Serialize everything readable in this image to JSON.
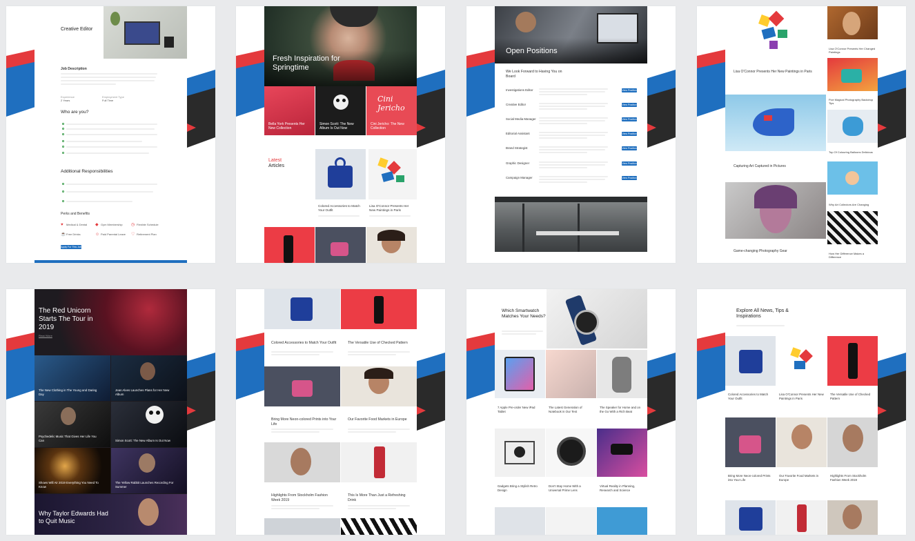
{
  "cards": {
    "c1": {
      "title": "Creative Editor",
      "job_description": "Job Description",
      "experience": "Experience",
      "experience_value": "2 Years",
      "employment": "Employment Type",
      "employment_value": "Full Time",
      "who_are_you": "Who are you?",
      "additional": "Additional Responsibilities",
      "perks": "Perks and Benefits",
      "perk_items": [
        "Medical & Dental",
        "Gym Membership",
        "Flexible Schedule",
        "Free Drinks",
        "Paid Parental Leave",
        "Retirement Plan"
      ],
      "apply": "Apply For This Job"
    },
    "c2": {
      "hero": "Fresh Inspiration for Springtime",
      "tiles": [
        "Bella York Presents Her New Collection",
        "Simon Scott: The New Album Is Out Now",
        "Cini Jericho: The New Collection"
      ],
      "latest_1": "Latest",
      "latest_2": "Articles",
      "articles": [
        "Colored Accessories to Match Your Outfit",
        "Lisa O'Connor Presents Her New Paintings in Paris"
      ]
    },
    "c3": {
      "hero": "Open Positions",
      "subheading": "We Look Forward to Having You on Board",
      "positions": [
        "Investigations Editor",
        "Creative Editor",
        "Social Media Manager",
        "Editorial Assistant",
        "Brand Strategist",
        "Graphic Designer",
        "Campaign Manager"
      ],
      "view_label": "View Position"
    },
    "c4": {
      "items": [
        "Lisa O'Connor Presents Her New Paintings in Paris",
        "Capturing Art Captured in Pictures",
        "Game-changing Photography Gear"
      ],
      "side_items": [
        "Lisa O'Connor Presents Her Changed Paintings",
        "Five Magical Photography Backdrop Tips",
        "Top Of Colouring Balloons Delicious",
        "Why Art Collectors Are Changing",
        "How Her Difference Makes a Difference"
      ]
    },
    "c5": {
      "hero": "The Red Unicorn Starts The Tour in 2019",
      "read_more": "Read More",
      "tiles": [
        "The New Clothing in The Young and Daring Day",
        "Jean Alves Launches Plans for Her New Album",
        "Psychedelic Music That Gives Her Life You Can",
        "Simon Scott: The New Album Is Out Now",
        "Shows Will Air 2019 Everything You Need To Know",
        "The Yellow Rabbit Launches Recording For Summer"
      ],
      "bottom": "Why Taylor Edwards Had to Quit Music"
    },
    "c6": {
      "articles": [
        "Colored Accessories to Match Your Outfit",
        "The Versatile Use of Checked Pattern",
        "Bring More Neon-colored Prints into Your Life",
        "Our Favorite Food Markets in Europe",
        "Highlights From Stockholm Fashion Week 2019",
        "This Is More Than Just a Refreshing Drink"
      ]
    },
    "c7": {
      "hero": "Which Smartwatch Matches Your Needs?",
      "articles": [
        "7 Apple Pre-order New iPad Tablet",
        "The Latest Generation of Notebook in Our Test",
        "The Speaker for Home and on the Go With a Rich Beat",
        "Gadgets Bring a Stylish Retro Design",
        "Don't Stay Home With a Universal Prime Lens",
        "Virtual Reality in Planning, Research and Science"
      ]
    },
    "c8": {
      "hero": "Explore All News, Tips & Inspirations",
      "articles": [
        "Colored Accessories to Match Your Outfit",
        "Lisa O'Connor Presents Her New Paintings in Paris",
        "The Versatile Use of Checked Pattern",
        "Bring More Neon-colored Prints into Your Life",
        "Our Favorite Food Markets in Europe",
        "Highlights From Stockholm Fashion Week 2019"
      ]
    }
  }
}
